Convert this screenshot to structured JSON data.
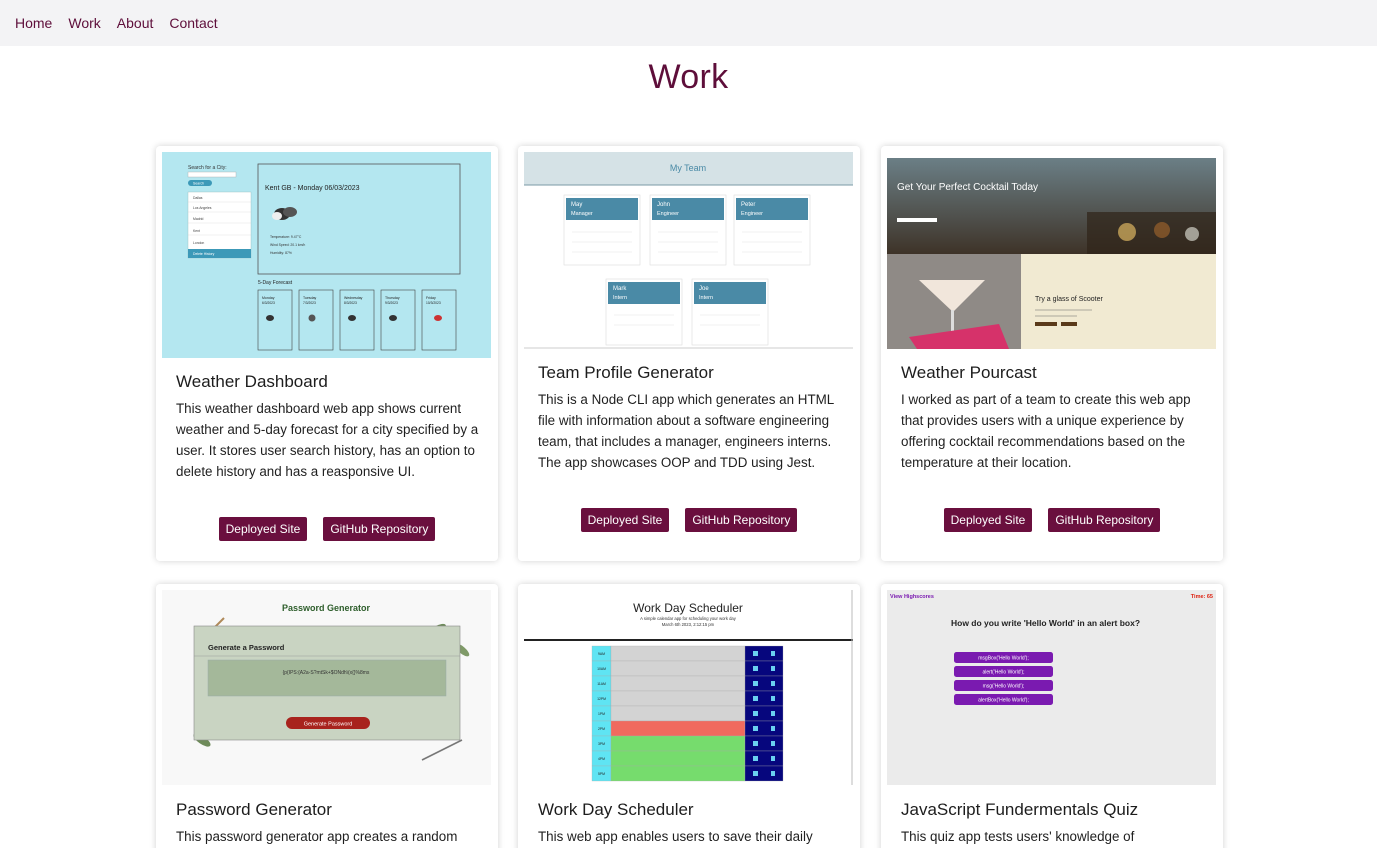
{
  "nav": {
    "items": [
      {
        "label": "Home"
      },
      {
        "label": "Work"
      },
      {
        "label": "About"
      },
      {
        "label": "Contact"
      }
    ]
  },
  "page": {
    "title": "Work"
  },
  "projects": [
    {
      "title": "Weather Dashboard",
      "description": "This weather dashboard web app shows current weather and 5-day forecast for a city specified by a user. It stores user search history, has an option to delete history and has a reasponsive UI.",
      "deployed_label": "Deployed Site",
      "repo_label": "GitHub Repository",
      "thumb": {
        "search_label": "Search for a City:",
        "search_button": "Search",
        "history": [
          "Dallas",
          "Los Angeles",
          "Madrid",
          "Kent",
          "London"
        ],
        "delete_history": "Delete History",
        "current_title": "Kent GB - Monday 06/03/2023",
        "current_lines": [
          "Temperature: 9.47°C",
          "Wind Speed: 20.1 km/h",
          "Humidity: 87%"
        ],
        "forecast_heading": "5-Day Forecast",
        "forecast": [
          {
            "day": "Monday",
            "date": "6/3/2023"
          },
          {
            "day": "Tuesday",
            "date": "7/3/2023"
          },
          {
            "day": "Wednesday",
            "date": "8/3/2023"
          },
          {
            "day": "Thursday",
            "date": "9/3/2023"
          },
          {
            "day": "Friday",
            "date": "10/3/2023"
          }
        ]
      }
    },
    {
      "title": "Team Profile Generator",
      "description": "This is a Node CLI app which generates an HTML file with information about a software engineering team, that includes a manager, engineers interns. The app showcases OOP and TDD using Jest.",
      "deployed_label": "Deployed Site",
      "repo_label": "GitHub Repository",
      "thumb": {
        "header": "My Team",
        "members": [
          {
            "name": "May",
            "role": "Manager"
          },
          {
            "name": "John",
            "role": "Engineer"
          },
          {
            "name": "Peter",
            "role": "Engineer"
          },
          {
            "name": "Mark",
            "role": "Intern"
          },
          {
            "name": "Joe",
            "role": "Intern"
          }
        ]
      }
    },
    {
      "title": "Weather Pourcast",
      "description": "I worked as part of a team to create this web app that provides users with a unique experience by offering cocktail recommendations based on the temperature at their location.",
      "deployed_label": "Deployed Site",
      "repo_label": "GitHub Repository",
      "thumb": {
        "hero": "Get Your Perfect Cocktail Today",
        "drink": "Try a glass of Scooter"
      }
    },
    {
      "title": "Password Generator",
      "description": "This password generator app creates a random",
      "thumb": {
        "header": "Password Generator",
        "panel_title": "Generate a Password",
        "password": "{p{IPS:{A2a-S?mtSk+$ONdh\\(x{}%8ms",
        "button": "Generate Password"
      }
    },
    {
      "title": "Work Day Scheduler",
      "description": "This web app enables users to save their daily",
      "thumb": {
        "header": "Work Day Scheduler",
        "subtitle": "A simple calendar app for scheduling your work day",
        "date": "March 6th 2023, 2:12:15 pm",
        "hours": [
          "9AM",
          "10AM",
          "11AM",
          "12PM",
          "1PM",
          "2PM",
          "3PM",
          "4PM",
          "5PM"
        ]
      }
    },
    {
      "title": "JavaScript Fundermentals Quiz",
      "description": "This quiz app tests users' knowledge of",
      "thumb": {
        "highscores": "View Highscores",
        "timer": "Time: 65",
        "question": "How do you write 'Hello World' in an alert box?",
        "answers": [
          "msgBox('Hello World');",
          "alert('Hello World');",
          "msg('Hello World');",
          "alertBox('Hello World');"
        ]
      }
    }
  ],
  "colors": {
    "accent": "#5e0e3a",
    "button": "#6a0f3e",
    "navbar": "#f3f3f5"
  }
}
